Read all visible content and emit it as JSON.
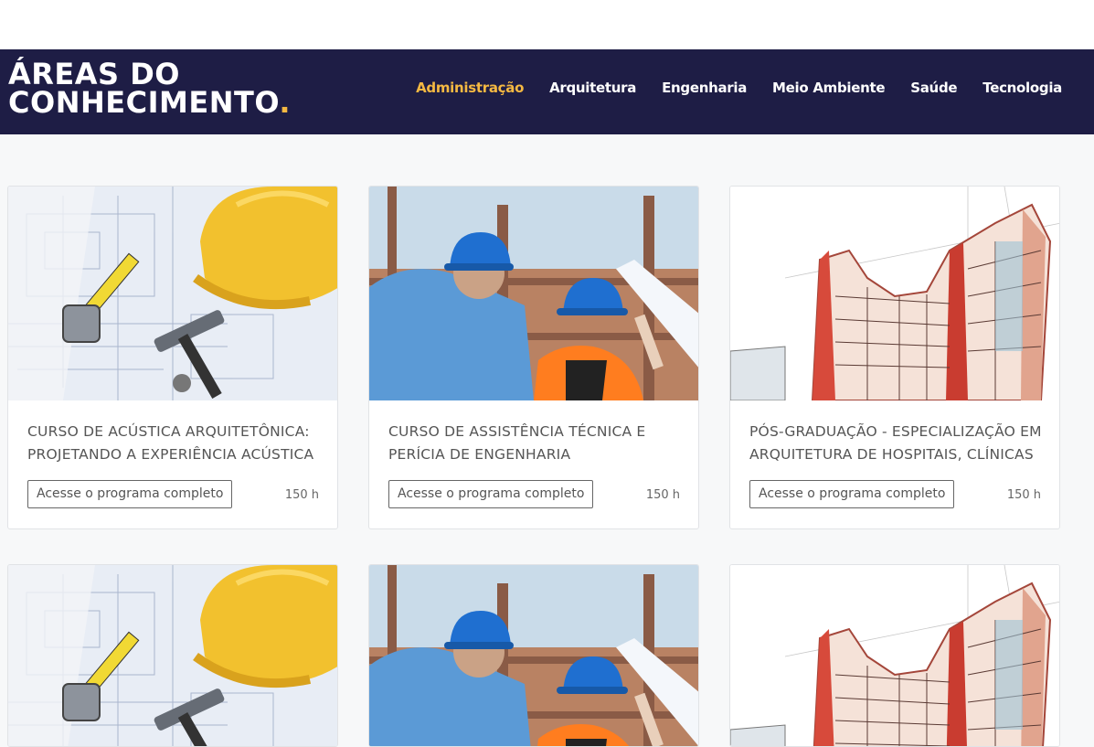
{
  "header": {
    "brand_line1": "ÁREAS DO",
    "brand_line2": "CONHECIMENTO",
    "brand_dot": ".",
    "nav": [
      "Administração",
      "Arquitetura",
      "Engenharia",
      "Meio Ambiente",
      "Saúde",
      "Tecnologia"
    ],
    "active_nav": "Administração"
  },
  "colors": {
    "header_bg": "#1e1d45",
    "accent": "#f5b942"
  },
  "courses": [
    {
      "title": "CURSO DE ACÚSTICA ARQUITETÔNICA: PROJETANDO A EXPERIÊNCIA ACÚSTICA",
      "button": "Acesse o programa completo",
      "hours": "150 h",
      "image": "blueprint-hardhat-tools"
    },
    {
      "title": "CURSO DE ASSISTÊNCIA TÉCNICA E PERÍCIA DE ENGENHARIA",
      "button": "Acesse o programa completo",
      "hours": "150 h",
      "image": "engineers-construction-site"
    },
    {
      "title": "PÓS-GRADUAÇÃO - ESPECIALIZAÇÃO EM ARQUITETURA DE HOSPITAIS, CLÍNICAS",
      "button": "Acesse o programa completo",
      "hours": "150 h",
      "image": "architecture-sketch-building"
    },
    {
      "image": "blueprint-hardhat-tools"
    },
    {
      "image": "engineers-construction-site"
    },
    {
      "image": "architecture-sketch-building"
    }
  ]
}
